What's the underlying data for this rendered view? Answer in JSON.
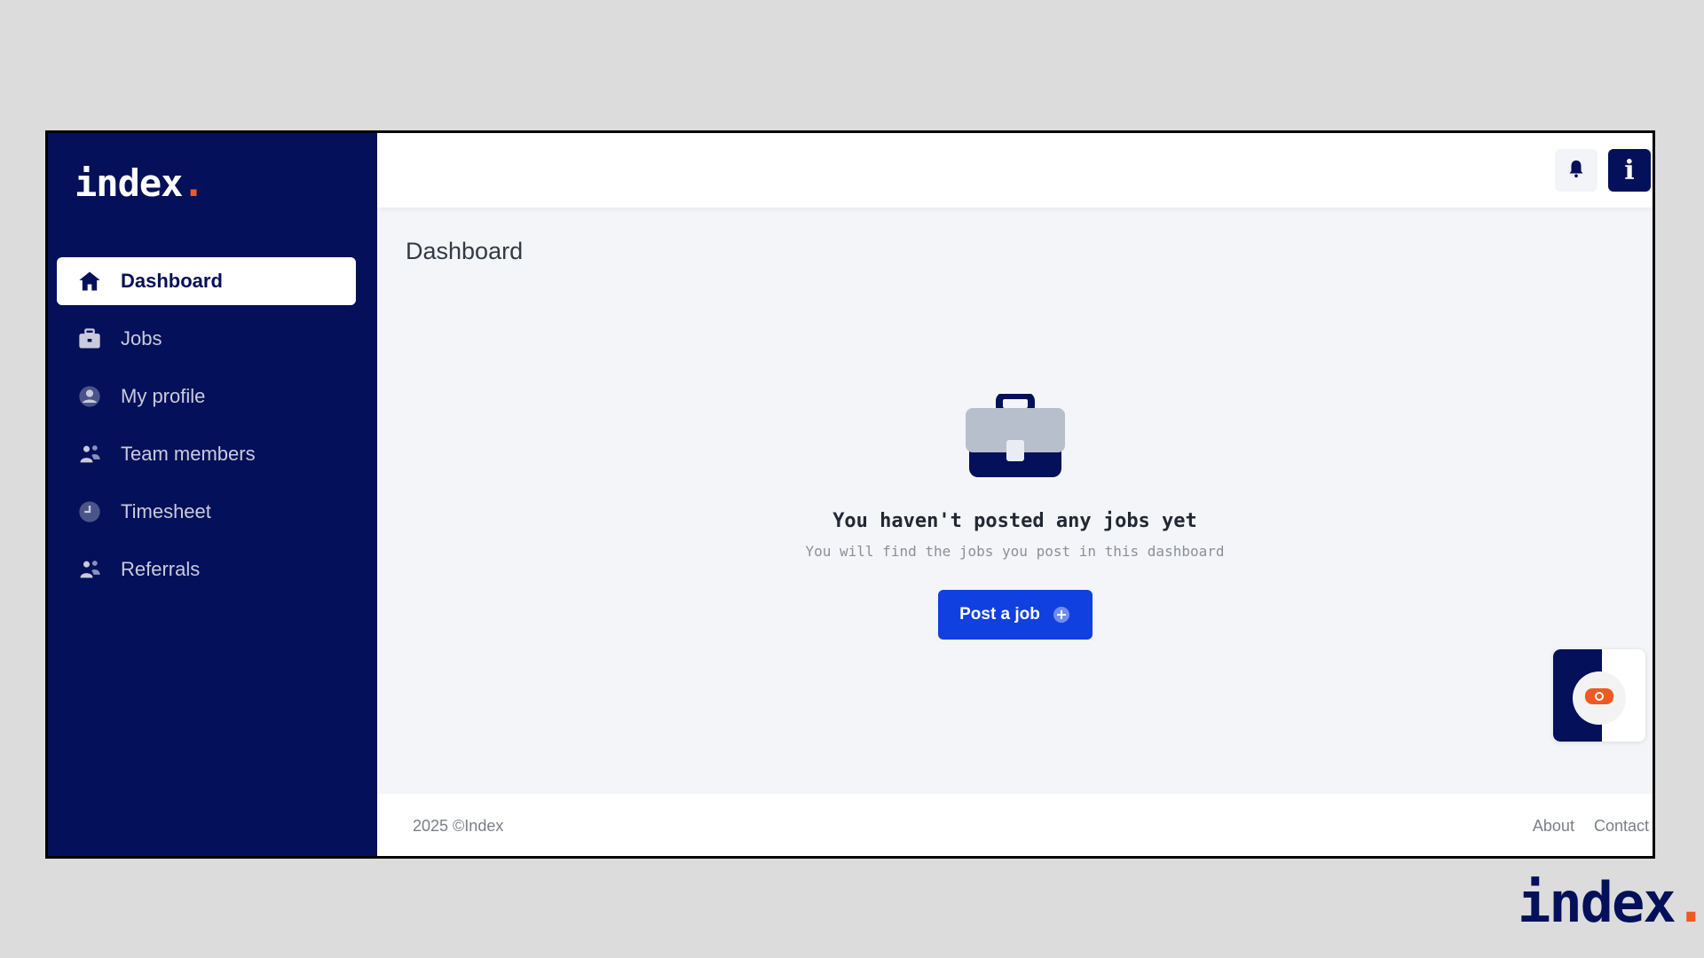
{
  "sidebar": {
    "logo_text": "index",
    "logo_dot": ".",
    "items": [
      {
        "label": "Dashboard",
        "icon": "home-icon",
        "active": true
      },
      {
        "label": "Jobs",
        "icon": "briefcase-icon"
      },
      {
        "label": "My profile",
        "icon": "user-circle-icon"
      },
      {
        "label": "Team members",
        "icon": "users-icon"
      },
      {
        "label": "Timesheet",
        "icon": "clock-icon"
      },
      {
        "label": "Referrals",
        "icon": "users-icon"
      }
    ]
  },
  "topbar": {
    "bell_icon": "bell-icon",
    "info_label": "i"
  },
  "main": {
    "title": "Dashboard",
    "empty_state": {
      "icon": "briefcase-icon",
      "title": "You haven't posted any jobs yet",
      "subtitle": "You will find the jobs you post in this dashboard",
      "button_label": "Post a job"
    }
  },
  "footer": {
    "copyright": "2025 ©Index",
    "about": "About",
    "contact": "Contact"
  },
  "watermark": {
    "text": "index",
    "dot": "."
  },
  "colors": {
    "sidebar_bg": "#041059",
    "accent_blue": "#1040e0",
    "brand_orange": "#f05a22"
  }
}
